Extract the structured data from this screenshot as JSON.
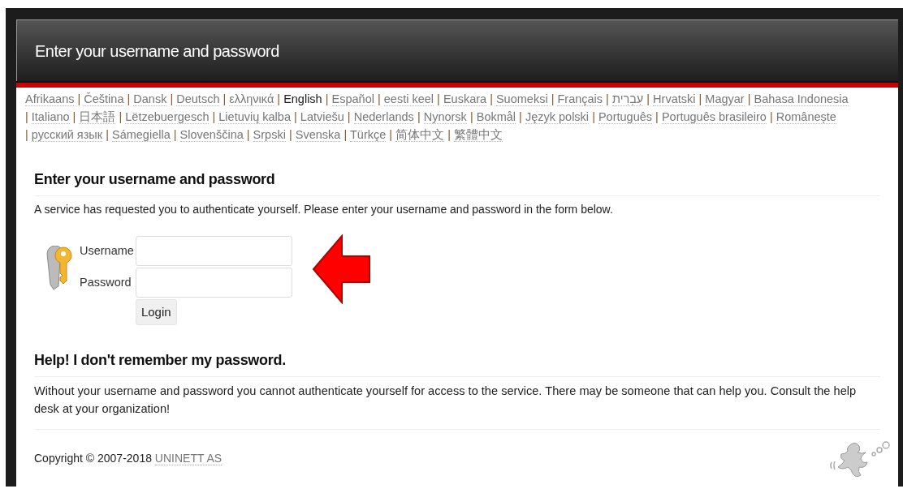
{
  "header": {
    "title": "Enter your username and password"
  },
  "languages": [
    {
      "label": "Afrikaans",
      "selected": false
    },
    {
      "label": "Čeština",
      "selected": false
    },
    {
      "label": "Dansk",
      "selected": false
    },
    {
      "label": "Deutsch",
      "selected": false
    },
    {
      "label": "ελληνικά",
      "selected": false
    },
    {
      "label": "English",
      "selected": true
    },
    {
      "label": "Español",
      "selected": false
    },
    {
      "label": "eesti keel",
      "selected": false
    },
    {
      "label": "Euskara",
      "selected": false
    },
    {
      "label": "Suomeksi",
      "selected": false
    },
    {
      "label": "Français",
      "selected": false
    },
    {
      "label": "עִבְרִית",
      "selected": false
    },
    {
      "label": "Hrvatski",
      "selected": false
    },
    {
      "label": "Magyar",
      "selected": false
    },
    {
      "label": "Bahasa Indonesia",
      "selected": false
    },
    {
      "label": "Italiano",
      "selected": false
    },
    {
      "label": "日本語",
      "selected": false
    },
    {
      "label": "Lëtzebuergesch",
      "selected": false
    },
    {
      "label": "Lietuvių kalba",
      "selected": false
    },
    {
      "label": "Latviešu",
      "selected": false
    },
    {
      "label": "Nederlands",
      "selected": false
    },
    {
      "label": "Nynorsk",
      "selected": false
    },
    {
      "label": "Bokmål",
      "selected": false
    },
    {
      "label": "Język polski",
      "selected": false
    },
    {
      "label": "Português",
      "selected": false
    },
    {
      "label": "Português brasileiro",
      "selected": false
    },
    {
      "label": "Românește",
      "selected": false
    },
    {
      "label": "русский язык",
      "selected": false
    },
    {
      "label": "Sámegiella",
      "selected": false
    },
    {
      "label": "Slovenščina",
      "selected": false
    },
    {
      "label": "Srpski",
      "selected": false
    },
    {
      "label": "Svenska",
      "selected": false
    },
    {
      "label": "Türkçe",
      "selected": false
    },
    {
      "label": "简体中文",
      "selected": false
    },
    {
      "label": "繁體中文",
      "selected": false
    }
  ],
  "separator": "|",
  "login": {
    "heading": "Enter your username and password",
    "intro": "A service has requested you to authenticate yourself. Please enter your username and password in the form below.",
    "username_label": "Username",
    "password_label": "Password",
    "button": "Login"
  },
  "help": {
    "heading": "Help! I don't remember my password.",
    "text": "Without your username and password you cannot authenticate yourself for access to the service. There may be someone that can help you. Consult the help desk at your organization!"
  },
  "footer": {
    "copyright": "Copyright © 2007-2018",
    "link": "UNINETT AS"
  }
}
